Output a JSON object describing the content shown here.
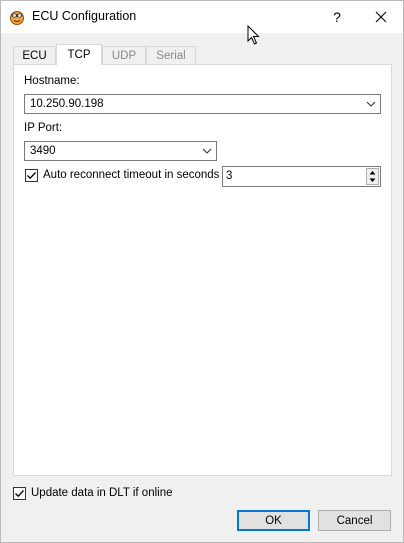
{
  "window": {
    "title": "ECU Configuration",
    "help_glyph": "?"
  },
  "tabs": [
    {
      "label": "ECU",
      "state": "normal"
    },
    {
      "label": "TCP",
      "state": "active"
    },
    {
      "label": "UDP",
      "state": "disabled"
    },
    {
      "label": "Serial",
      "state": "disabled"
    }
  ],
  "tcp": {
    "hostname_label": "Hostname:",
    "hostname_value": "10.250.90.198",
    "ip_port_label": "IP Port:",
    "ip_port_value": "3490",
    "auto_reconnect_label": "Auto reconnect timeout in seconds",
    "auto_reconnect_checked": true,
    "timeout_value": "3"
  },
  "footer": {
    "update_label": "Update data in DLT if online",
    "update_checked": true,
    "ok_label": "OK",
    "cancel_label": "Cancel"
  },
  "colors": {
    "accent": "#0078d7"
  }
}
